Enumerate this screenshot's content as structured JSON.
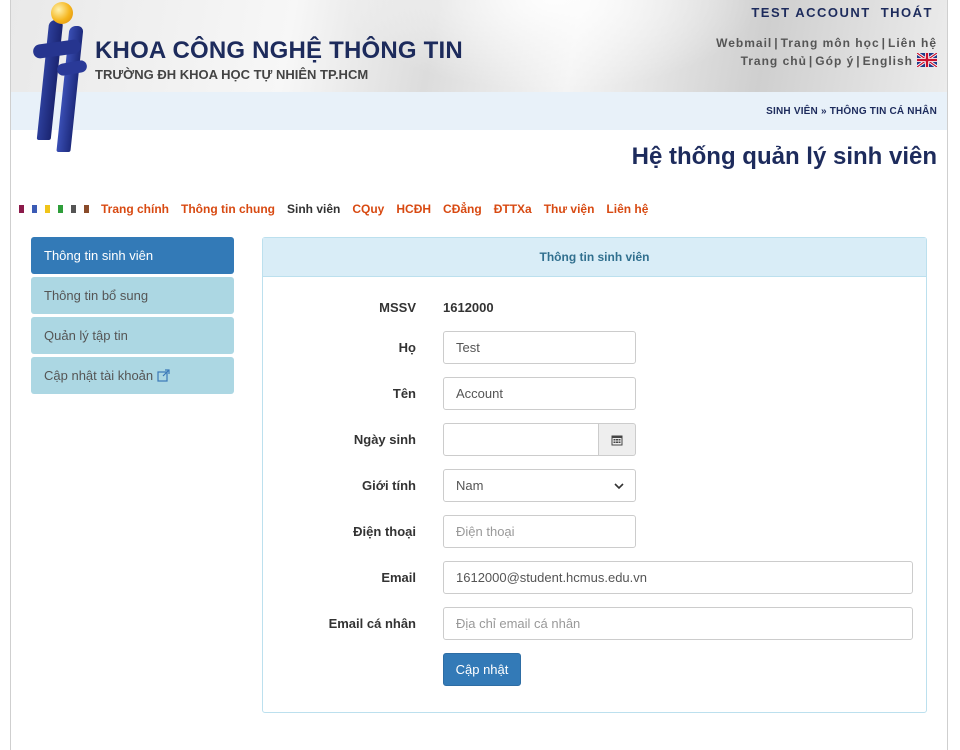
{
  "header": {
    "faculty_title": "KHOA CÔNG NGHỆ THÔNG TIN",
    "school_subtitle": "TRƯỜNG ĐH KHOA HỌC TỰ NHIÊN TP.HCM",
    "account": {
      "username": "TEST ACCOUNT",
      "logout": "THOÁT"
    },
    "top_links_row1": [
      "Webmail",
      "Trang môn học",
      "Liên hệ"
    ],
    "top_links_row2": [
      "Trang chủ",
      "Góp ý",
      "English"
    ],
    "separator": "|",
    "breadcrumb": [
      "SINH VIÊN",
      "THÔNG TIN CÁ NHÂN"
    ],
    "breadcrumb_sep": "»"
  },
  "page_title": "Hệ thống quản lý sinh viên",
  "main_nav": {
    "square_colors": [
      "#8b1a4a",
      "#3b5bb5",
      "#f0c419",
      "#2e9e3a",
      "#555555",
      "#8a4b2a"
    ],
    "items": [
      {
        "label": "Trang chính",
        "style": "red"
      },
      {
        "label": "Thông tin chung",
        "style": "red"
      },
      {
        "label": "Sinh viên",
        "style": "dark"
      },
      {
        "label": "CQuy",
        "style": "red"
      },
      {
        "label": "HCĐH",
        "style": "red"
      },
      {
        "label": "CĐẳng",
        "style": "red"
      },
      {
        "label": "ĐTTXa",
        "style": "red"
      },
      {
        "label": "Thư viện",
        "style": "red"
      },
      {
        "label": "Liên hệ",
        "style": "red"
      }
    ]
  },
  "sidebar": {
    "items": [
      {
        "label": "Thông tin sinh viên",
        "active": true
      },
      {
        "label": "Thông tin bổ sung",
        "active": false
      },
      {
        "label": "Quản lý tập tin",
        "active": false
      },
      {
        "label": "Cập nhật tài khoản",
        "active": false,
        "icon": "external-link-icon"
      }
    ]
  },
  "panel": {
    "heading": "Thông tin sinh viên",
    "fields": {
      "mssv": {
        "label": "MSSV",
        "value": "1612000"
      },
      "ho": {
        "label": "Họ",
        "value": "Test"
      },
      "ten": {
        "label": "Tên",
        "value": "Account"
      },
      "ngay_sinh": {
        "label": "Ngày sinh",
        "value": "",
        "icon": "calendar-icon"
      },
      "gioi_tinh": {
        "label": "Giới tính",
        "selected": "Nam",
        "icon": "chevron-down-icon"
      },
      "dien_thoai": {
        "label": "Điện thoại",
        "placeholder": "Điện thoại"
      },
      "email": {
        "label": "Email",
        "value": "1612000@student.hcmus.edu.vn"
      },
      "email_ca_nhan": {
        "label": "Email cá nhân",
        "placeholder": "Địa chỉ email cá nhân"
      }
    },
    "submit_label": "Cập nhật"
  },
  "colors": {
    "brand_dark": "#1d2b5c",
    "nav_red": "#d84a12",
    "primary_button": "#337ab7",
    "sidebar_inactive": "#acd7e3",
    "panel_heading_bg": "#d9edf7",
    "panel_heading_text": "#31708f"
  }
}
